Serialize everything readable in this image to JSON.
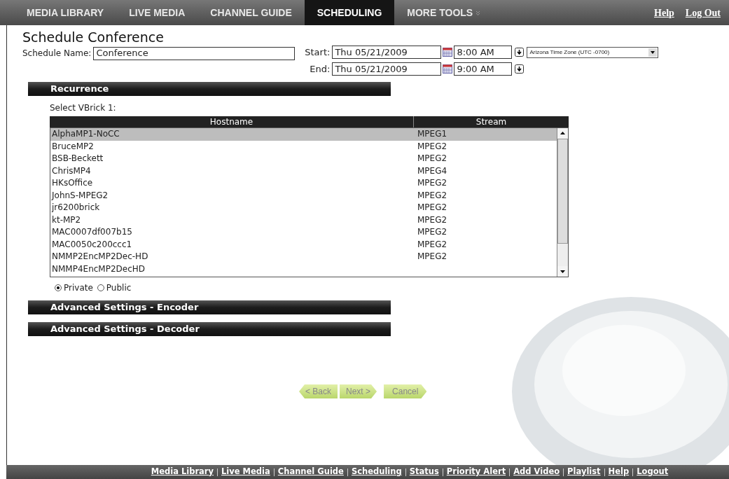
{
  "nav": {
    "tabs": [
      {
        "label": "MEDIA LIBRARY",
        "selected": false
      },
      {
        "label": "LIVE MEDIA",
        "selected": false
      },
      {
        "label": "CHANNEL GUIDE",
        "selected": false
      },
      {
        "label": "SCHEDULING",
        "selected": true
      },
      {
        "label": "MORE TOOLS",
        "selected": false,
        "kind": "menu"
      }
    ],
    "links": [
      "Help",
      "Log Out"
    ]
  },
  "title": "Schedule Conference",
  "schedule_name": {
    "label": "Schedule Name:",
    "value": "Conference"
  },
  "start": {
    "label": "Start:",
    "date": "Thu 05/21/2009",
    "time": "8:00 AM",
    "timezone": "Arizona Time Zone (UTC -0700)"
  },
  "end": {
    "label": "End:",
    "date": "Thu 05/21/2009",
    "time": "9:00 AM"
  },
  "recurrence": {
    "title": "Recurrence",
    "select_label": "Select VBrick 1:",
    "columns": [
      "Hostname",
      "Stream"
    ],
    "rows": [
      {
        "hostname": "AlphaMP1-NoCC",
        "stream": "MPEG1",
        "selected": true
      },
      {
        "hostname": "BruceMP2",
        "stream": "MPEG2",
        "selected": false
      },
      {
        "hostname": "BSB-Beckett",
        "stream": "MPEG2",
        "selected": false
      },
      {
        "hostname": "ChrisMP4",
        "stream": "MPEG4",
        "selected": false
      },
      {
        "hostname": "HKsOffice",
        "stream": "MPEG2",
        "selected": false
      },
      {
        "hostname": "JohnS-MPEG2",
        "stream": "MPEG2",
        "selected": false
      },
      {
        "hostname": "jr6200brick",
        "stream": "MPEG2",
        "selected": false
      },
      {
        "hostname": "kt-MP2",
        "stream": "MPEG2",
        "selected": false
      },
      {
        "hostname": "MAC0007df007b15",
        "stream": "MPEG2",
        "selected": false
      },
      {
        "hostname": "MAC0050c200ccc1",
        "stream": "MPEG2",
        "selected": false
      },
      {
        "hostname": "NMMP2EncMP2Dec-HD",
        "stream": "MPEG2",
        "selected": false
      },
      {
        "hostname": "NMMP4EncMP2DecHD",
        "stream": "",
        "selected": false
      }
    ],
    "visibility": [
      {
        "label": "Private",
        "selected": true
      },
      {
        "label": "Public",
        "selected": false
      }
    ]
  },
  "sections": [
    "Advanced Settings - Encoder",
    "Advanced Settings - Decoder"
  ],
  "buttons": [
    "< Back",
    "Next >",
    "Cancel"
  ],
  "footer_links": [
    "Media Library",
    "Live Media",
    "Channel Guide",
    "Scheduling",
    "Status",
    "Priority Alert",
    "Add Video",
    "Playlist",
    "Help",
    "Logout"
  ]
}
